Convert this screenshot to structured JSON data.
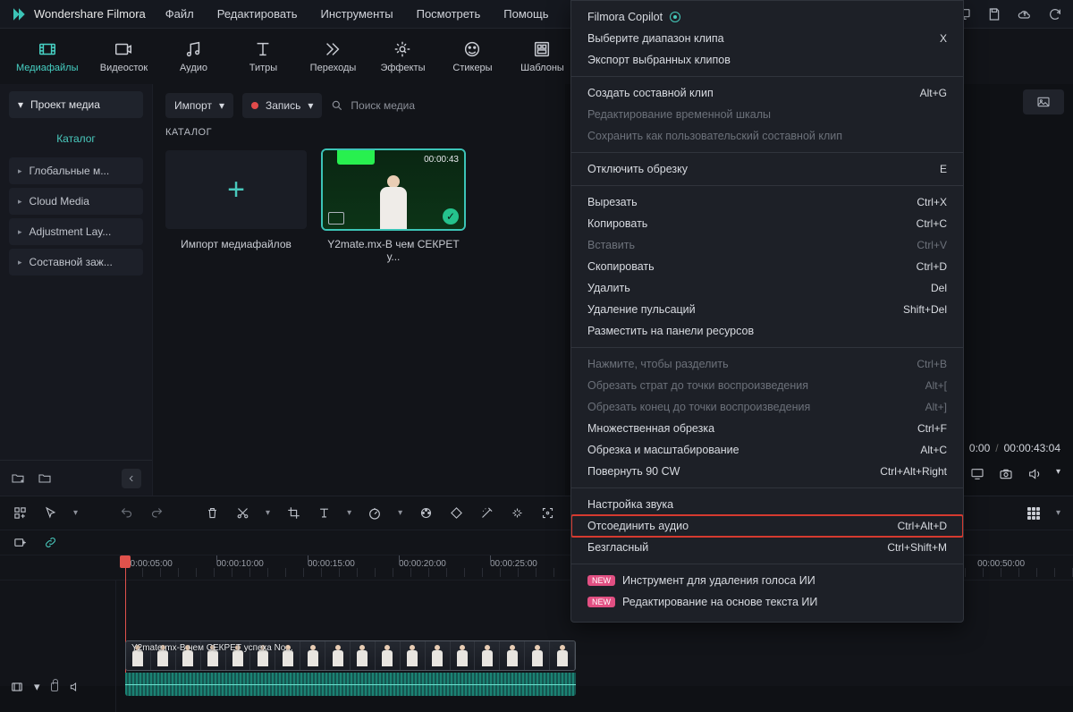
{
  "app_title": "Wondershare Filmora",
  "menubar": [
    "Файл",
    "Редактировать",
    "Инструменты",
    "Посмотреть",
    "Помощь"
  ],
  "tabs": [
    {
      "label": "Медиафайлы"
    },
    {
      "label": "Видеосток"
    },
    {
      "label": "Аудио"
    },
    {
      "label": "Титры"
    },
    {
      "label": "Переходы"
    },
    {
      "label": "Эффекты"
    },
    {
      "label": "Стикеры"
    },
    {
      "label": "Шаблоны"
    }
  ],
  "sidebar": {
    "header": "Проект медиа",
    "catalog_label": "Каталог",
    "items": [
      {
        "label": "Глобальные м..."
      },
      {
        "label": "Cloud Media"
      },
      {
        "label": "Adjustment Lay..."
      },
      {
        "label": "Составной заж..."
      }
    ]
  },
  "center": {
    "import": "Импорт",
    "record": "Запись",
    "search_placeholder": "Поиск медиа",
    "catalog_heading": "КАТАЛОГ",
    "thumbs": [
      {
        "caption": "Импорт медиафайлов"
      },
      {
        "caption": "Y2mate.mx-В чем СЕКРЕТ у...",
        "duration": "00:00:43"
      }
    ]
  },
  "preview": {
    "current_time": "0:00",
    "total_time": "00:00:43:04"
  },
  "timeline": {
    "marks": [
      "00:00:05:00",
      "00:00:10:00",
      "00:00:15:00",
      "00:00:20:00",
      "00:00:25:00"
    ],
    "far_mark": "00:00:50:00",
    "clip_label": "Y2mate.mx-В чем СЕКРЕТ успеха No..."
  },
  "context_menu": [
    {
      "label": "Filmora Copilot",
      "type": "copilot"
    },
    {
      "label": "Выберите диапазон клипа",
      "shortcut": "X"
    },
    {
      "label": "Экспорт выбранных клипов"
    },
    {
      "sep": true
    },
    {
      "label": "Создать составной клип",
      "shortcut": "Alt+G"
    },
    {
      "label": "Редактирование временной шкалы",
      "disabled": true
    },
    {
      "label": "Сохранить как пользовательский составной клип",
      "disabled": true
    },
    {
      "sep": true
    },
    {
      "label": "Отключить обрезку",
      "shortcut": "E"
    },
    {
      "sep": true
    },
    {
      "label": "Вырезать",
      "shortcut": "Ctrl+X"
    },
    {
      "label": "Копировать",
      "shortcut": "Ctrl+C"
    },
    {
      "label": "Вставить",
      "shortcut": "Ctrl+V",
      "disabled": true
    },
    {
      "label": "Скопировать",
      "shortcut": "Ctrl+D"
    },
    {
      "label": "Удалить",
      "shortcut": "Del"
    },
    {
      "label": "Удаление пульсаций",
      "shortcut": "Shift+Del"
    },
    {
      "label": "Разместить на панели ресурсов"
    },
    {
      "sep": true
    },
    {
      "label": "Нажмите, чтобы разделить",
      "shortcut": "Ctrl+B",
      "disabled": true
    },
    {
      "label": "Обрезать страт до точки воспроизведения",
      "shortcut": "Alt+[",
      "disabled": true
    },
    {
      "label": "Обрезать конец до точки воспроизведения",
      "shortcut": "Alt+]",
      "disabled": true
    },
    {
      "label": "Множественная обрезка",
      "shortcut": "Ctrl+F"
    },
    {
      "label": "Обрезка и масштабирование",
      "shortcut": "Alt+C"
    },
    {
      "label": "Повернуть 90 CW",
      "shortcut": "Ctrl+Alt+Right"
    },
    {
      "sep": true
    },
    {
      "label": "Настройка звука"
    },
    {
      "label": "Отсоединить аудио",
      "shortcut": "Ctrl+Alt+D",
      "highlight": true
    },
    {
      "label": "Безгласный",
      "shortcut": "Ctrl+Shift+M"
    },
    {
      "sep": true
    },
    {
      "label": "Инструмент для удаления голоса ИИ",
      "new": true
    },
    {
      "label": "Редактирование на основе текста ИИ",
      "new": true
    }
  ]
}
